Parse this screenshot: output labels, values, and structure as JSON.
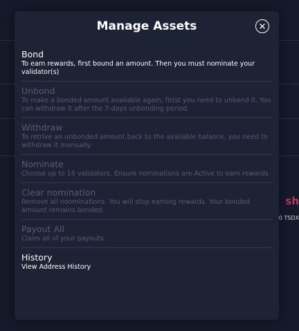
{
  "background": {
    "peek_label": "sh",
    "peek_subtext": "0 TSDX"
  },
  "modal": {
    "title": "Manage Assets",
    "close_icon": "close-icon"
  },
  "options": [
    {
      "title": "Bond",
      "description": "To earn rewards, first bound an amount. Then you must nominate your validator(s)",
      "active": true
    },
    {
      "title": "Unbond",
      "description": "To make a bonded amount available again, firtst you need to unbond it. You can withdraw it after the 7-days unbonding period.",
      "active": false
    },
    {
      "title": "Withdraw",
      "description": "To retrive an unbonded amount back to the available balance, you need to withdraw it manually.",
      "active": false
    },
    {
      "title": "Nominate",
      "description": "Choose up to 16 validators. Ensure nominations are Active to earn rewards",
      "active": false
    },
    {
      "title": "Clear nomination",
      "description": "Remove all noominations. You will stop earning rewards. Your bonded amount remains bonded.",
      "active": false
    },
    {
      "title": "Payout All",
      "description": "Claim all of your payouts.",
      "active": false
    },
    {
      "title": "History",
      "description": "View Address History",
      "active": true
    }
  ],
  "colors": {
    "background": "#15192a",
    "modal": "#1d2235",
    "active_text": "#ffffff",
    "inactive_text": "#565c70",
    "accent": "#c2335f"
  }
}
